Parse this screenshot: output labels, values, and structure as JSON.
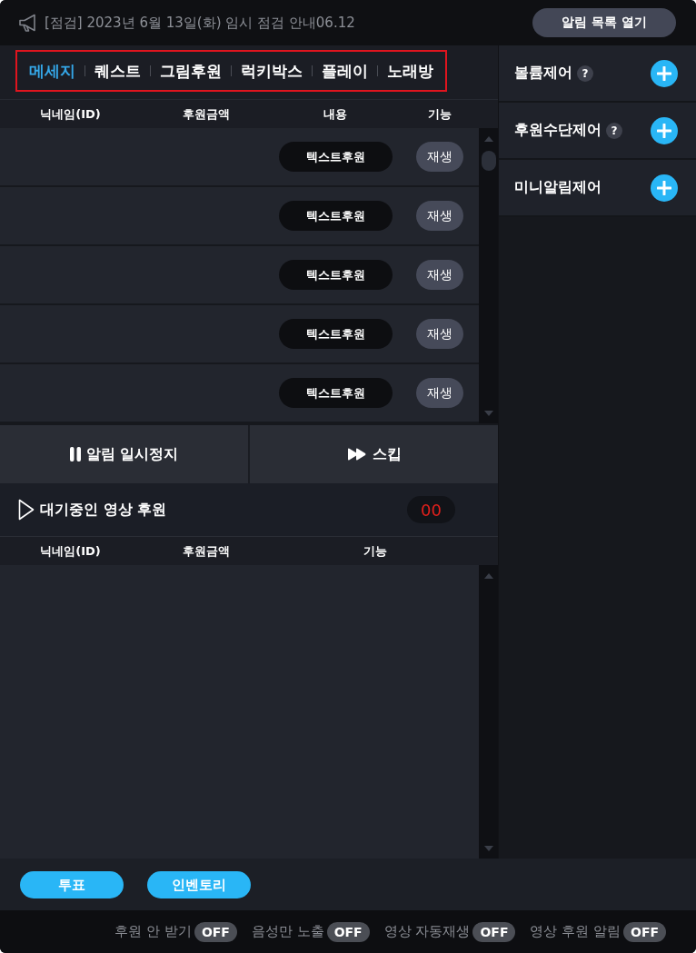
{
  "notice": {
    "text": "[점검] 2023년 6월 13일(화) 임시 점검 안내06.12",
    "button": "알림 목록 열기"
  },
  "tab_bar": {
    "highlighted": true,
    "tabs": [
      {
        "label": "메세지",
        "selected": true
      },
      {
        "label": "퀘스트",
        "selected": false
      },
      {
        "label": "그림후원",
        "selected": false
      },
      {
        "label": "럭키박스",
        "selected": false
      },
      {
        "label": "플레이",
        "selected": false
      },
      {
        "label": "노래방",
        "selected": false
      }
    ]
  },
  "donations": {
    "columns": [
      "닉네임(ID)",
      "후원금액",
      "내용",
      "기능"
    ],
    "rows": [
      {
        "content": "텍스트후원",
        "action": "재생"
      },
      {
        "content": "텍스트후원",
        "action": "재생"
      },
      {
        "content": "텍스트후원",
        "action": "재생"
      },
      {
        "content": "텍스트후원",
        "action": "재생"
      },
      {
        "content": "텍스트후원",
        "action": "재생"
      }
    ]
  },
  "controls": [
    {
      "kind": "pause",
      "label": "알림 일시정지"
    },
    {
      "kind": "skip",
      "label": "스킵"
    }
  ],
  "queue": {
    "title": "대기중인 영상 후원",
    "count": "00",
    "columns": [
      "닉네임(ID)",
      "후원금액",
      "기능"
    ]
  },
  "side_panel": {
    "items": [
      {
        "label": "볼륨제어",
        "help": "?"
      },
      {
        "label": "후원수단제어",
        "help": "?"
      },
      {
        "label": "미니알림제어"
      }
    ]
  },
  "actions": [
    "투표",
    "인벤토리"
  ],
  "toggles": [
    {
      "label": "후원 안 받기",
      "on": false,
      "state": "OFF"
    },
    {
      "label": "음성만 노출",
      "on": false,
      "state": "OFF"
    },
    {
      "label": "영상 자동재생",
      "on": false,
      "state": "OFF"
    },
    {
      "label": "영상 후원 알림",
      "on": false,
      "state": "OFF"
    }
  ]
}
